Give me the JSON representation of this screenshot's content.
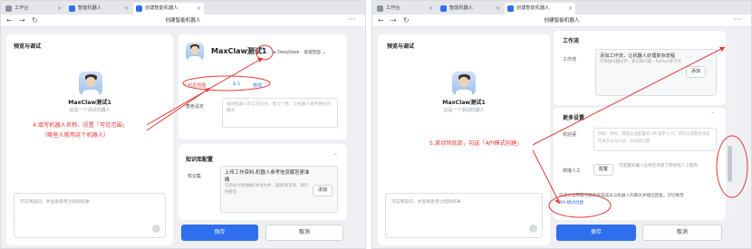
{
  "left": {
    "tabs": [
      {
        "label": "工作台"
      },
      {
        "label": "智能机器人"
      },
      {
        "label": "创建智能机器人"
      }
    ],
    "nav": {
      "back": "←",
      "forward": "→",
      "reload": "↻",
      "title": "创建智能机器人",
      "more": "···"
    },
    "preview": {
      "title": "预览与调试",
      "bot_name": "MaxClaw测试1",
      "bot_desc": "这是一个测试机器人",
      "chat_placeholder": "可向我提问，并查看思考过程和结果"
    },
    "config": {
      "bot_name": "MaxClaw测试1",
      "edit_icon": "pencil-icon",
      "model": "DeepSeek · 快速回答",
      "visibility_label": "* 可见范围",
      "visibility_value": "& 1",
      "modify_link": "修改",
      "role_label": "角色设定",
      "role_placeholder": "描述机器人的工作任务、能力个性、让机器人提供更好的服务",
      "kb_title": "知识库配置",
      "kb_label": "知识集",
      "kb_text": "上传工作资料,机器人参考信息解答更准确",
      "kb_sub": "可添加文档/数据/本地文件、链接/网页和、网页链接等",
      "add_button": "添加",
      "save_button": "保存",
      "cancel_button": "取消"
    },
    "annotation": {
      "line1": "4.填写机器人名称、设置「可见范围」",
      "line2": "（哪些人能用这个机器人）"
    }
  },
  "right": {
    "tabs": [
      {
        "label": "工作台"
      },
      {
        "label": "智能机器人"
      },
      {
        "label": "创建智能机器人"
      }
    ],
    "nav": {
      "back": "←",
      "forward": "→",
      "reload": "↻",
      "title": "创建智能机器人",
      "more": "···"
    },
    "preview": {
      "title": "预览与调试",
      "bot_name": "MaxClaw测试1",
      "bot_desc": "这是一个测试机器人",
      "chat_placeholder": "可向我提问，并查看思考过程和结果"
    },
    "config": {
      "workflow_title": "工作流",
      "workflow_label": "工作流",
      "workflow_text": "添加工作流，让机器人处理复杂流程",
      "workflow_sub": "可添加问题分步、知识库问题、Python等节点",
      "add_button": "添加",
      "more_title": "更多设置",
      "welcome_label": "欢迎语",
      "welcome_placeholder": "例如：你好，我是企业配置的 HR 助手小 H，你可以向我咨询任何关于公司人员、培训的问题",
      "transfer_label": "转接人工",
      "transfer_button": "配置",
      "transfer_desc": "可配置机器人在特定场景下转接给人工服务",
      "api_desc": "可通过调用服务器系统或成员与机器人的聊天并输出回复，可切换至",
      "api_link": "API 模式创建",
      "save_button": "保存",
      "cancel_button": "取消"
    },
    "annotation": {
      "line1": "5.滚动到底部，勾选「API模式创建」"
    }
  }
}
